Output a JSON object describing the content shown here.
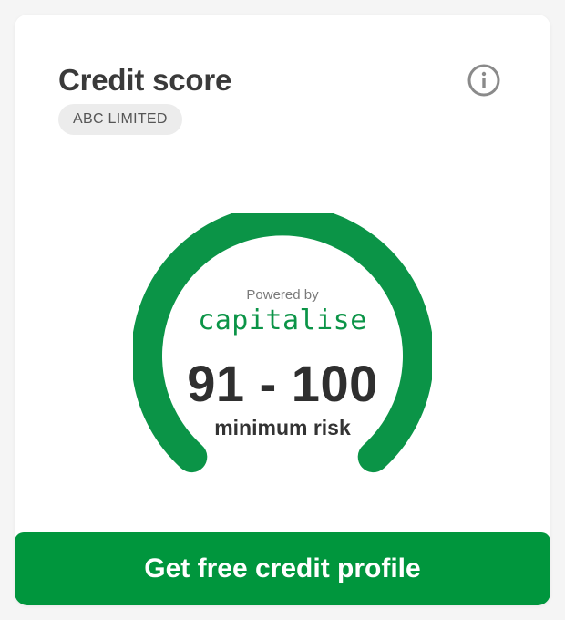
{
  "card": {
    "title": "Credit score",
    "company_badge": "ABC LIMITED"
  },
  "gauge": {
    "powered_by": "Powered by",
    "brand": "capitalise",
    "score_range": "91 - 100",
    "risk_label": "minimum risk",
    "fill_fraction": 1.0,
    "color": "#0b9447"
  },
  "icons": {
    "info": "info-icon"
  },
  "cta": {
    "label": "Get free credit profile",
    "color": "#00963d"
  }
}
